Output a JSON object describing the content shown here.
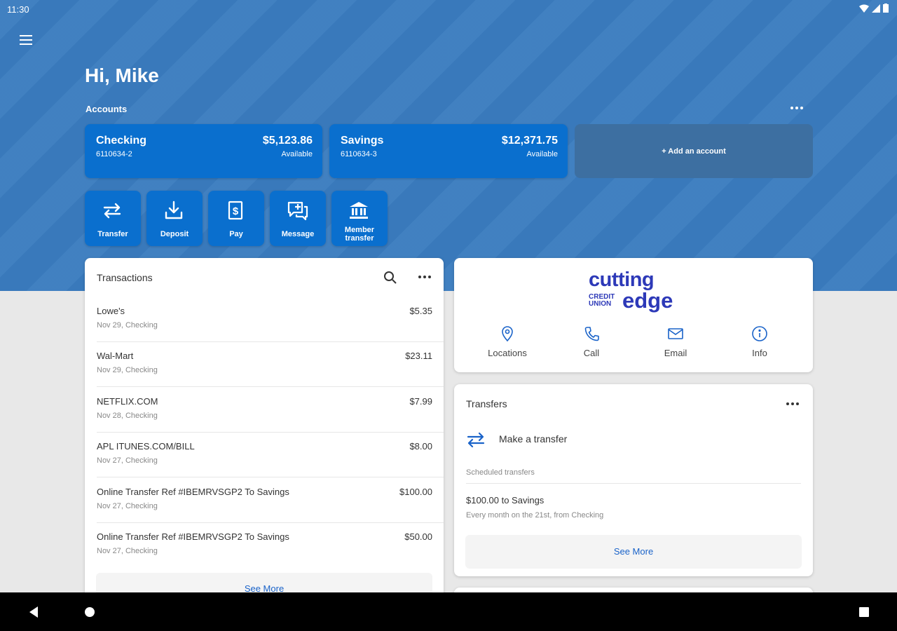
{
  "status_bar": {
    "time": "11:30"
  },
  "header": {
    "greeting": "Hi, Mike",
    "accounts_label": "Accounts"
  },
  "accounts": [
    {
      "name": "Checking",
      "number": "6110634-2",
      "balance": "$5,123.86",
      "available_label": "Available"
    },
    {
      "name": "Savings",
      "number": "6110634-3",
      "balance": "$12,371.75",
      "available_label": "Available"
    }
  ],
  "add_account_label": "+ Add an account",
  "quick_actions": [
    {
      "label": "Transfer",
      "icon": "transfer-icon"
    },
    {
      "label": "Deposit",
      "icon": "deposit-icon"
    },
    {
      "label": "Pay",
      "icon": "pay-icon"
    },
    {
      "label": "Message",
      "icon": "message-icon"
    },
    {
      "label": "Member transfer",
      "icon": "bank-icon"
    }
  ],
  "transactions": {
    "title": "Transactions",
    "items": [
      {
        "name": "Lowe's",
        "date": "Nov 29, Checking",
        "amount": "$5.35"
      },
      {
        "name": "Wal-Mart",
        "date": "Nov 29, Checking",
        "amount": "$23.11"
      },
      {
        "name": "NETFLIX.COM",
        "date": "Nov 28, Checking",
        "amount": "$7.99"
      },
      {
        "name": "APL ITUNES.COM/BILL",
        "date": "Nov 27, Checking",
        "amount": "$8.00"
      },
      {
        "name": "Online Transfer Ref #IBEMRVSGP2 To Savings",
        "date": "Nov 27, Checking",
        "amount": "$100.00"
      },
      {
        "name": "Online Transfer Ref #IBEMRVSGP2 To Savings",
        "date": "Nov 27, Checking",
        "amount": "$50.00"
      }
    ],
    "see_more": "See More"
  },
  "brand": {
    "line1": "cutting",
    "line2": "edge",
    "sub1": "CREDIT",
    "sub2": "UNION"
  },
  "contacts": [
    {
      "label": "Locations",
      "icon": "location-pin-icon"
    },
    {
      "label": "Call",
      "icon": "phone-icon"
    },
    {
      "label": "Email",
      "icon": "email-icon"
    },
    {
      "label": "Info",
      "icon": "info-icon"
    }
  ],
  "transfers": {
    "title": "Transfers",
    "make_transfer": "Make a transfer",
    "scheduled_label": "Scheduled transfers",
    "scheduled": [
      {
        "title": "$100.00 to Savings",
        "detail": "Every month on the 21st, from Checking"
      }
    ],
    "see_more": "See More"
  },
  "colors": {
    "hero": "#3a7cbf",
    "card_blue": "#0a6fce",
    "brand": "#2d39b8",
    "link": "#1a63c9"
  }
}
